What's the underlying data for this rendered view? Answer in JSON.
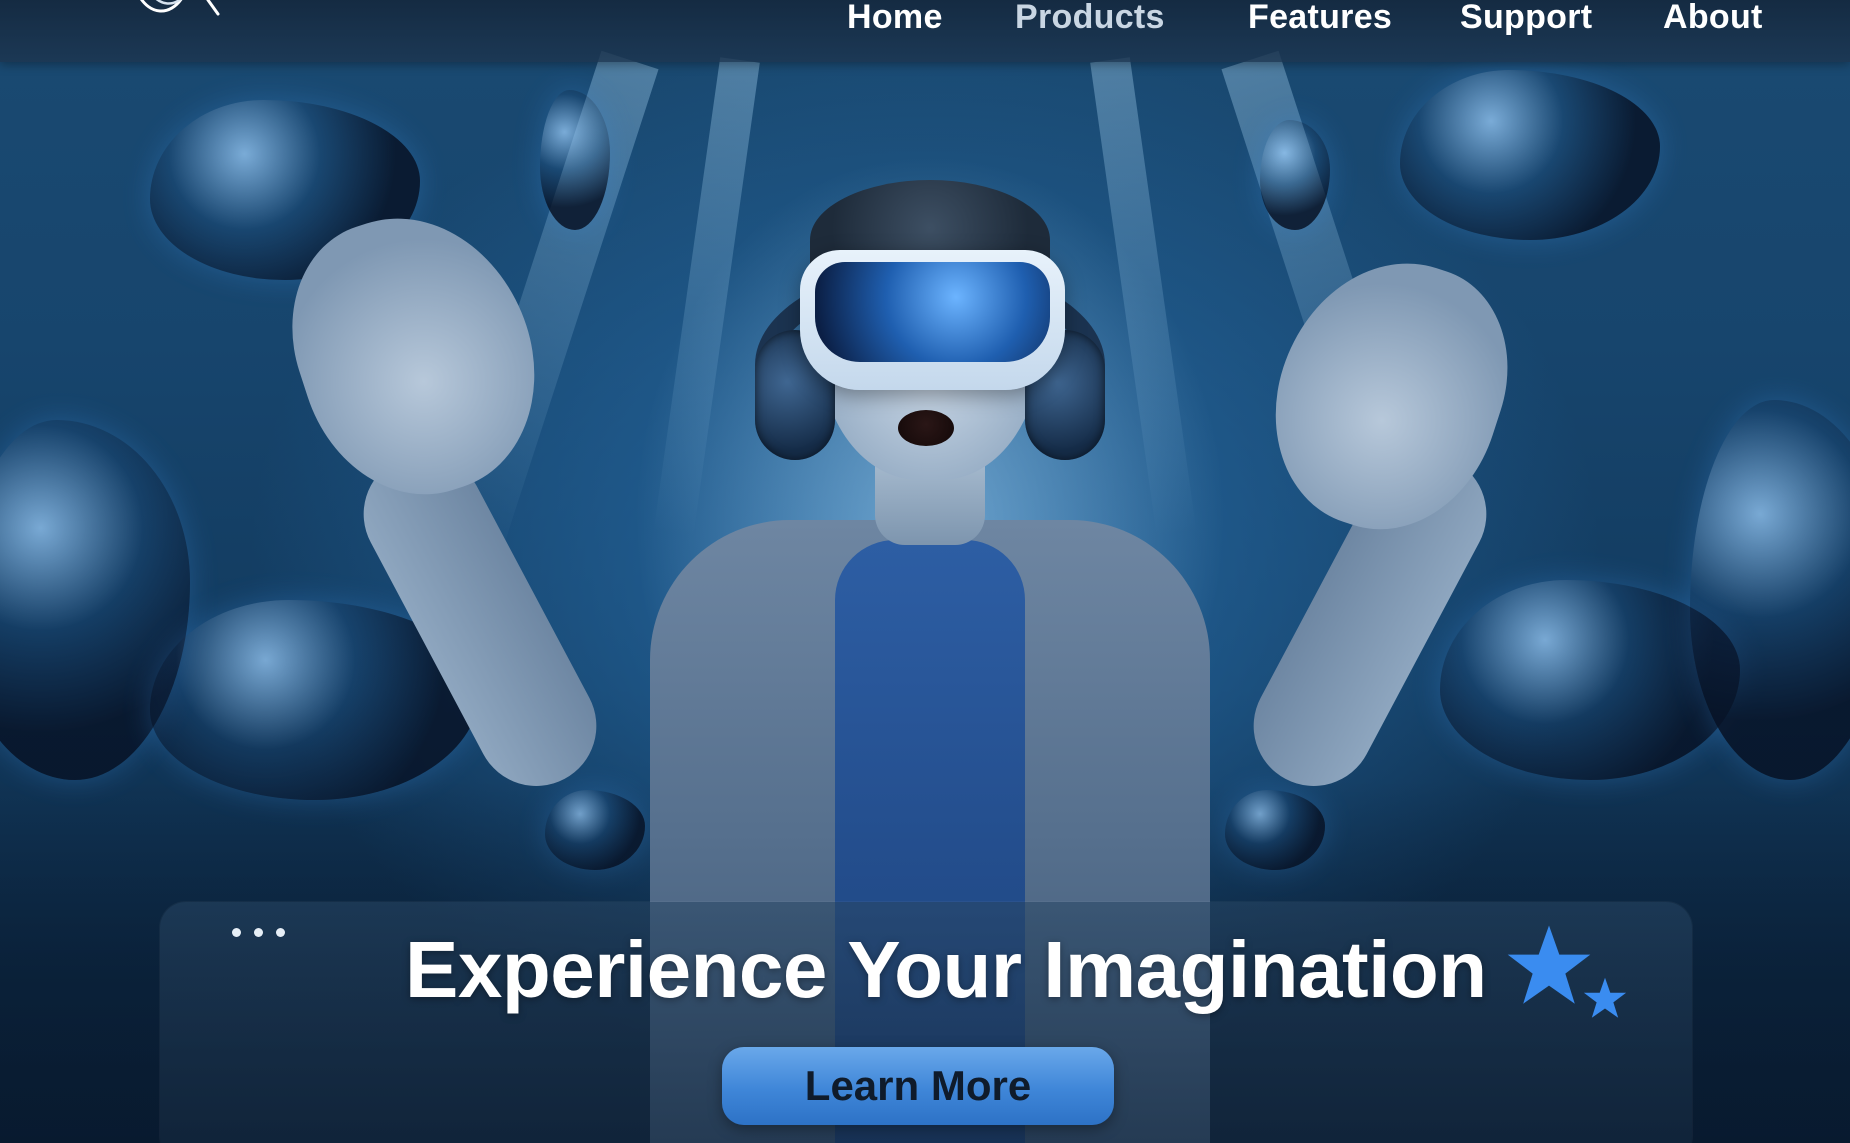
{
  "nav": {
    "items": [
      {
        "label": "Home",
        "dimmed": false
      },
      {
        "label": "Products",
        "dimmed": true
      },
      {
        "label": "Features",
        "dimmed": false
      },
      {
        "label": "Support",
        "dimmed": false
      },
      {
        "label": "About",
        "dimmed": false
      }
    ]
  },
  "logo": {
    "icon": "brand-logo-icon"
  },
  "hero": {
    "headline": "Experience Your Imagination",
    "cta_label": "Learn More",
    "image_subject": "child wearing VR headset with raised hands",
    "decorations": [
      "ellipsis-dots-icon",
      "star-icon",
      "star-small-icon"
    ]
  },
  "colors": {
    "accent": "#3f86d8",
    "star": "#3a8cf0",
    "text": "#ffffff",
    "button_text": "#0f1b2b",
    "background": "#17456d"
  }
}
